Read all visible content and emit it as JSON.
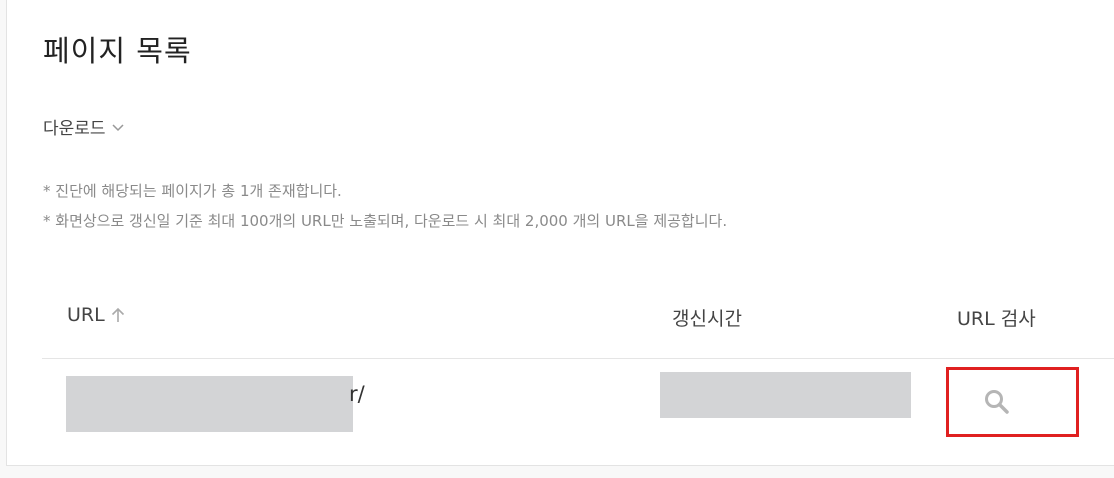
{
  "page": {
    "title": "페이지 목록",
    "download_label": "다운로드",
    "notes": [
      "* 진단에 해당되는 페이지가 총 1개 존재합니다.",
      "* 화면상으로 갱신일 기준 최대 100개의 URL만 노출되며, 다운로드 시 최대 2,000 개의 URL을 제공합니다."
    ]
  },
  "table": {
    "columns": {
      "url": "URL",
      "updated": "갱신시간",
      "inspect": "URL 검사"
    },
    "rows": [
      {
        "url_visible_suffix": "r/"
      }
    ]
  },
  "icons": {
    "download": "chevron-down-icon",
    "sort": "arrow-up-icon",
    "inspect": "search-icon"
  },
  "colors": {
    "highlight": "#e02020",
    "redaction": "#d3d4d6"
  }
}
